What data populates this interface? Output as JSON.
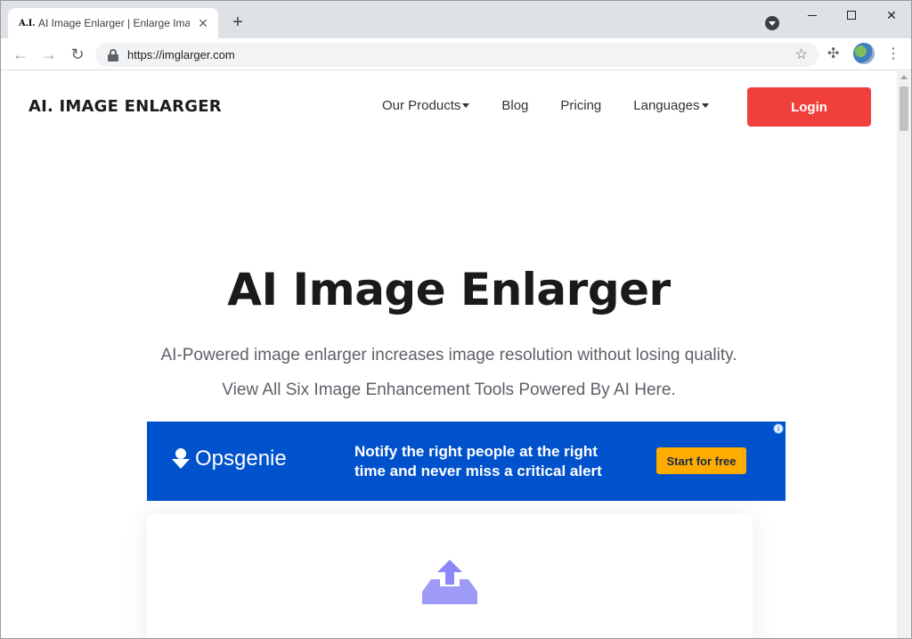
{
  "browser": {
    "tab": {
      "favicon_text": "A.I.",
      "title": "AI Image Enlarger | Enlarge Imag"
    },
    "address_bar": {
      "url": "https://imglarger.com"
    }
  },
  "site": {
    "logo": "AI. IMAGE ENLARGER",
    "nav": {
      "items": [
        {
          "label": "Our Products",
          "has_dropdown": true
        },
        {
          "label": "Blog",
          "has_dropdown": false
        },
        {
          "label": "Pricing",
          "has_dropdown": false
        },
        {
          "label": "Languages",
          "has_dropdown": true
        }
      ],
      "login_label": "Login"
    }
  },
  "hero": {
    "title": "AI Image Enlarger",
    "subtitle": "AI-Powered image enlarger increases image resolution without losing quality.",
    "subtitle2": "View All Six Image Enhancement Tools Powered By AI Here."
  },
  "ad": {
    "brand": "Opsgenie",
    "line1": "Notify the right people at the right",
    "line2": "time and never miss a critical alert",
    "cta": "Start for free"
  },
  "colors": {
    "login": "#f0403b",
    "ad_background": "#0052cc",
    "ad_cta": "#ffab00",
    "upload_icon": "#8c88f7"
  },
  "icons": {
    "tab_close": "close-icon",
    "new_tab": "plus-icon",
    "back": "arrow-left-icon",
    "forward": "arrow-right-icon",
    "reload": "reload-icon",
    "secure": "lock-icon",
    "bookmark": "star-icon",
    "extensions": "puzzle-icon",
    "menu": "kebab-menu-icon",
    "upload": "upload-icon"
  }
}
